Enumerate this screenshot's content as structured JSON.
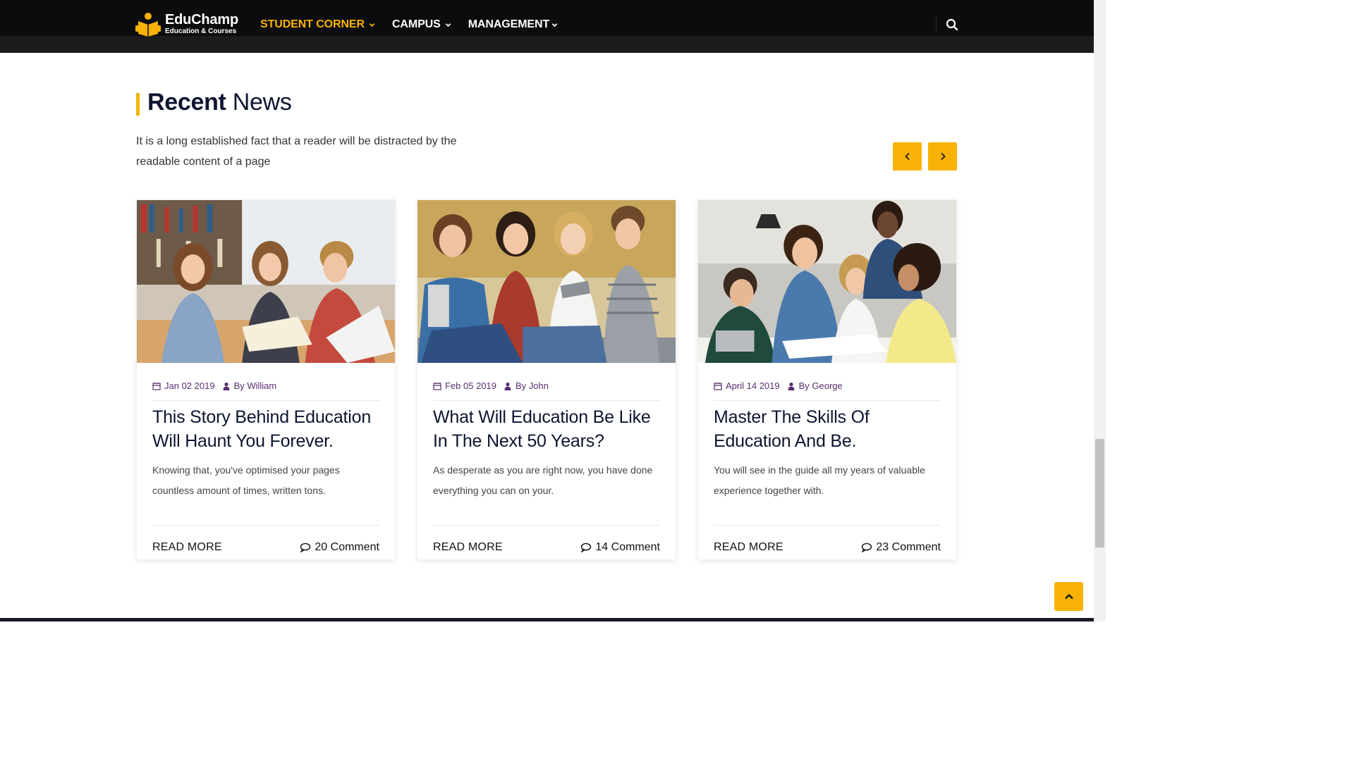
{
  "brand": {
    "name": "EduChamp",
    "tagline": "Education & Courses",
    "accent": "#f7b205"
  },
  "nav": {
    "items": [
      {
        "label": "STUDENT CORNER",
        "active": true
      },
      {
        "label": "CAMPUS",
        "active": false
      },
      {
        "label": "MANAGEMENT",
        "active": false
      }
    ],
    "search_icon": "search-icon"
  },
  "section": {
    "title_bold": "Recent",
    "title_light": "News",
    "description": "It is a long established fact that a reader will be distracted by the readable content of a page"
  },
  "carousel": {
    "prev_icon": "chevron-left-icon",
    "next_icon": "chevron-right-icon"
  },
  "cards": [
    {
      "date": "Jan 02 2019",
      "author": "By William",
      "title": "This Story Behind Education Will Haunt You Forever.",
      "text": "Knowing that, you've optimised your pages countless amount of times, written tons.",
      "read_more": "READ MORE",
      "comments": "20 Comment"
    },
    {
      "date": "Feb 05 2019",
      "author": "By John",
      "title": "What Will Education Be Like In The Next 50 Years?",
      "text": "As desperate as you are right now, you have done everything you can on your.",
      "read_more": "READ MORE",
      "comments": "14 Comment"
    },
    {
      "date": "April 14 2019",
      "author": "By George",
      "title": "Master The Skills Of Education And Be.",
      "text": "You will see in the guide all my years of valuable experience together with.",
      "read_more": "READ MORE",
      "comments": "23 Comment"
    }
  ],
  "back_to_top_icon": "chevron-up-icon"
}
